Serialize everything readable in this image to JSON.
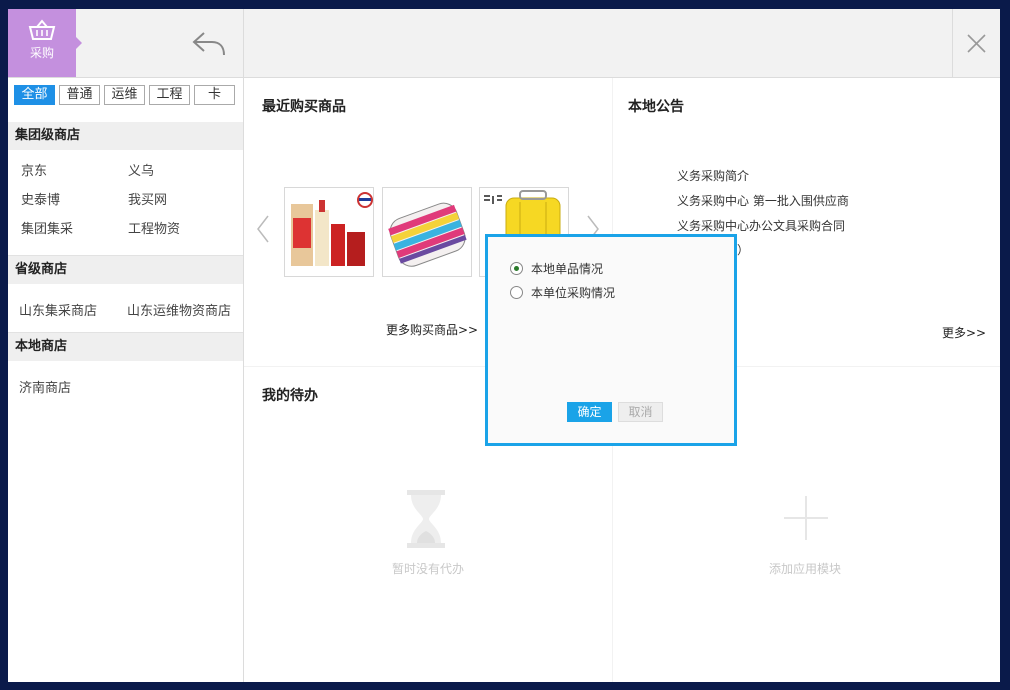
{
  "app": {
    "logo_label": "采购"
  },
  "filters": [
    "全部",
    "普通",
    "运维",
    "工程",
    "卡"
  ],
  "sections": {
    "group": {
      "title": "集团级商店",
      "shops": [
        "京东",
        "义乌",
        "史泰博",
        "我买网",
        "集团集采",
        "工程物资"
      ]
    },
    "province": {
      "title": "省级商店",
      "shops": [
        "山东集采商店",
        "山东运维物资商店"
      ]
    },
    "local": {
      "title": "本地商店",
      "shops": [
        "济南商店"
      ]
    }
  },
  "recent": {
    "title": "最近购买商品",
    "more": "更多购买商品>>"
  },
  "notices": {
    "title": "本地公告",
    "items": [
      "义务采购简介",
      "义务采购中心 第一批入围供应商",
      "义务采购中心办公文具采购合同",
      "单（最终版）"
    ],
    "more": "更多>>"
  },
  "todo": {
    "title": "我的待办",
    "empty": "暂时没有代办"
  },
  "addmodule": {
    "label": "添加应用模块"
  },
  "dialog": {
    "options": [
      "本地单品情况",
      "本单位采购情况"
    ],
    "selected": 0,
    "ok": "确定",
    "cancel": "取消"
  },
  "colors": {
    "accent": "#1aa3e8",
    "logo_bg": "#c490de",
    "active_filter": "#1e90e6"
  }
}
